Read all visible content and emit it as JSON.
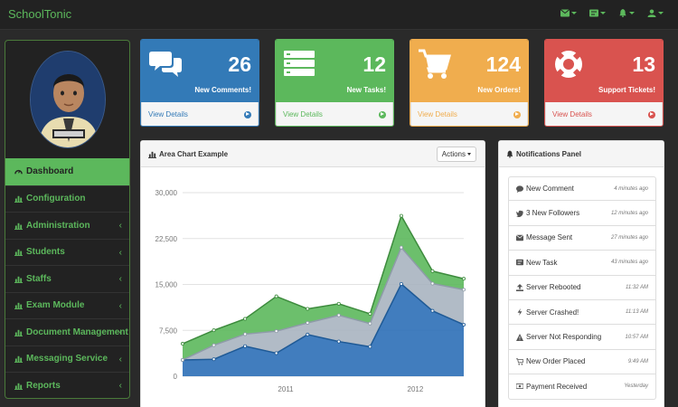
{
  "app": {
    "brand": "SchoolTonic"
  },
  "navbar": {
    "icons": [
      "envelope-icon",
      "tasks-icon",
      "bell-icon",
      "user-icon"
    ]
  },
  "sidebar": {
    "items": [
      {
        "label": "Dashboard",
        "active": true,
        "submenu": false
      },
      {
        "label": "Configuration",
        "submenu": false
      },
      {
        "label": "Administration",
        "submenu": true
      },
      {
        "label": "Students",
        "submenu": true
      },
      {
        "label": "Staffs",
        "submenu": true
      },
      {
        "label": "Exam Module",
        "submenu": true
      },
      {
        "label": "Document Management",
        "submenu": true
      },
      {
        "label": "Messaging Service",
        "submenu": true
      },
      {
        "label": "Reports",
        "submenu": true
      }
    ]
  },
  "cards": [
    {
      "count": "26",
      "label": "New Comments!",
      "link": "View Details",
      "color": "#337ab7",
      "icon": "comments-icon"
    },
    {
      "count": "12",
      "label": "New Tasks!",
      "link": "View Details",
      "color": "#5cb85c",
      "icon": "tasks-icon"
    },
    {
      "count": "124",
      "label": "New Orders!",
      "link": "View Details",
      "color": "#f0ad4e",
      "icon": "shopping-cart-icon"
    },
    {
      "count": "13",
      "label": "Support Tickets!",
      "link": "View Details",
      "color": "#d9534f",
      "icon": "support-icon"
    }
  ],
  "area_panel": {
    "title": "Area Chart Example",
    "actions_label": "Actions"
  },
  "chart_data": {
    "type": "area",
    "title": "Area Chart Example",
    "x_tick_labels": [
      "2011",
      "2012"
    ],
    "y_tick_labels": [
      "0",
      "7,500",
      "15,000",
      "22,500",
      "30,000"
    ],
    "ylim": [
      0,
      30000
    ],
    "grid": true,
    "stacked": true,
    "x": [
      0,
      1,
      2,
      3,
      4,
      5,
      6,
      7,
      8,
      9
    ],
    "series": [
      {
        "color": "#2c6fb7",
        "values": [
          2666,
          2778,
          4912,
          3767,
          6810,
          5670,
          4820,
          15073,
          10687,
          8432
        ]
      },
      {
        "color": "#a8b4c0",
        "values": [
          0,
          2294,
          1969,
          3597,
          1914,
          4293,
          3795,
          5967,
          4460,
          5713
        ]
      },
      {
        "color": "#5cb85c",
        "values": [
          2647,
          2441,
          2501,
          5689,
          2293,
          1881,
          1588,
          5175,
          2028,
          1791
        ]
      }
    ]
  },
  "notifications": {
    "title": "Notifications Panel",
    "items": [
      {
        "text": "New Comment",
        "time": "4 minutes ago",
        "icon": "comment-icon"
      },
      {
        "text": "3 New Followers",
        "time": "12 minutes ago",
        "icon": "twitter-icon"
      },
      {
        "text": "Message Sent",
        "time": "27 minutes ago",
        "icon": "envelope-icon"
      },
      {
        "text": "New Task",
        "time": "43 minutes ago",
        "icon": "tasks-icon"
      },
      {
        "text": "Server Rebooted",
        "time": "11:32 AM",
        "icon": "upload-icon"
      },
      {
        "text": "Server Crashed!",
        "time": "11:13 AM",
        "icon": "bolt-icon"
      },
      {
        "text": "Server Not Responding",
        "time": "10:57 AM",
        "icon": "warning-icon"
      },
      {
        "text": "New Order Placed",
        "time": "9:49 AM",
        "icon": "shopping-cart-icon"
      },
      {
        "text": "Payment Received",
        "time": "Yesterday",
        "icon": "money-icon"
      }
    ]
  },
  "colors": {
    "accent": "#5cb85c",
    "dark": "#222222"
  }
}
